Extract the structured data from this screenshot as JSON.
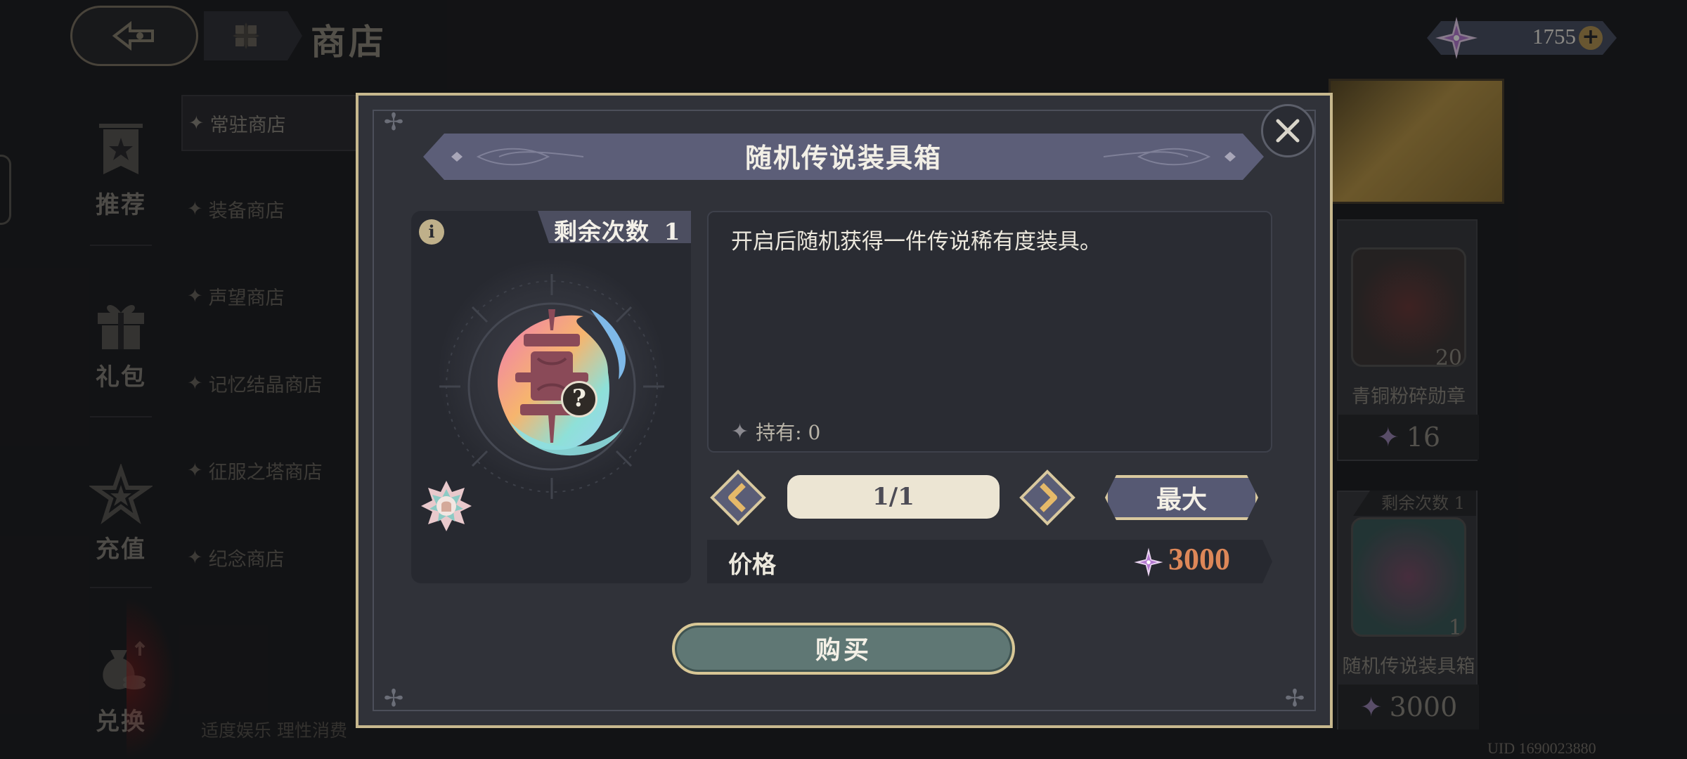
{
  "shop": {
    "title": "商店",
    "currency_value": "1755",
    "nav": [
      {
        "label": "推荐"
      },
      {
        "label": "礼包"
      },
      {
        "label": "充值"
      },
      {
        "label": "兑换"
      }
    ],
    "sub_nav": [
      {
        "label": "常驻商店",
        "active": true
      },
      {
        "label": "装备商店"
      },
      {
        "label": "声望商店"
      },
      {
        "label": "记忆结晶商店"
      },
      {
        "label": "征服之塔商店"
      },
      {
        "label": "纪念商店"
      }
    ],
    "footer_note": "适度娱乐 理性消费",
    "cards": [
      {
        "name": "青铜粉碎勋章",
        "count": "20",
        "price": "16"
      },
      {
        "name": "随机传说装具箱",
        "count": "1",
        "price": "3000",
        "remain": "剩余次数 1"
      }
    ],
    "uid": "UID 1690023880"
  },
  "modal": {
    "title": "随机传说装具箱",
    "remain_label": "剩余次数",
    "remain_count": "1",
    "item_badge": "?",
    "description": "开启后随机获得一件传说稀有度装具。",
    "owned": "持有: 0",
    "quantity": "1/1",
    "max_label": "最大",
    "price_label": "价格",
    "price_value": "3000",
    "buy_label": "购买"
  },
  "colors": {
    "frame_gold": "#c7b88e",
    "price_orange": "#dd8758",
    "panel": "#303239"
  }
}
